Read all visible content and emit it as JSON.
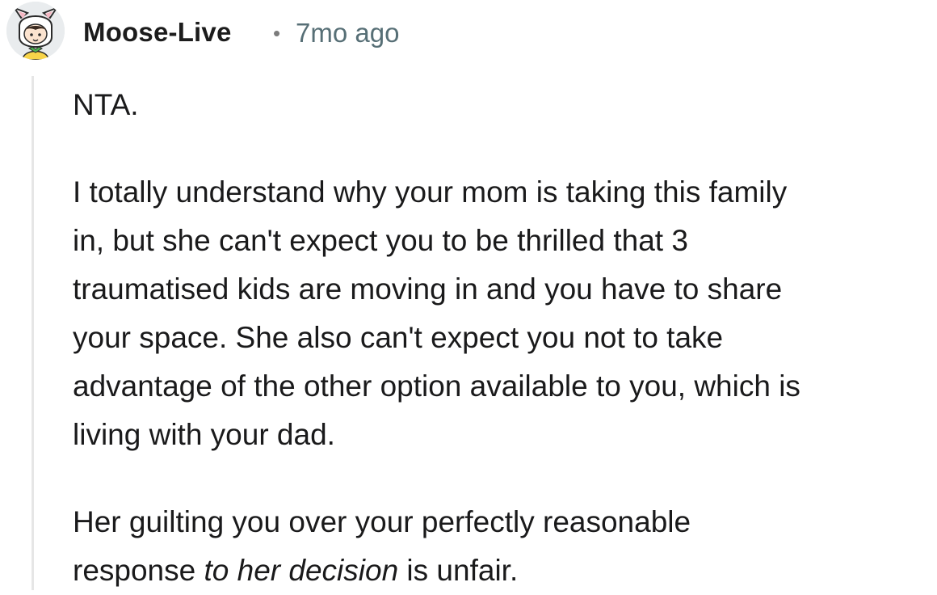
{
  "comment": {
    "author": "Moose-Live",
    "separator": "•",
    "timestamp": "7mo ago",
    "avatar_icon": "snoo-avatar-icon",
    "paragraphs": {
      "p1": "NTA.",
      "p2": {
        "line1": "I totally understand why your mom is taking this family",
        "line2": "in, but she can't expect you to be thrilled that 3",
        "line3": "traumatised kids are moving in and you have to share",
        "line4": "your space. She also can't expect you not to take",
        "line5": "advantage of the other option available to you, which is",
        "line6": "living with your dad."
      },
      "p3": {
        "line1": "Her guilting you over your perfectly reasonable",
        "line2_start": "response ",
        "line2_italic": "to her decision",
        "line2_end": " is unfair."
      }
    }
  },
  "colors": {
    "text": "#1a1a1b",
    "meta": "#576f76",
    "thread_line": "#e6e6e6",
    "avatar_bg": "#e9ecee"
  }
}
